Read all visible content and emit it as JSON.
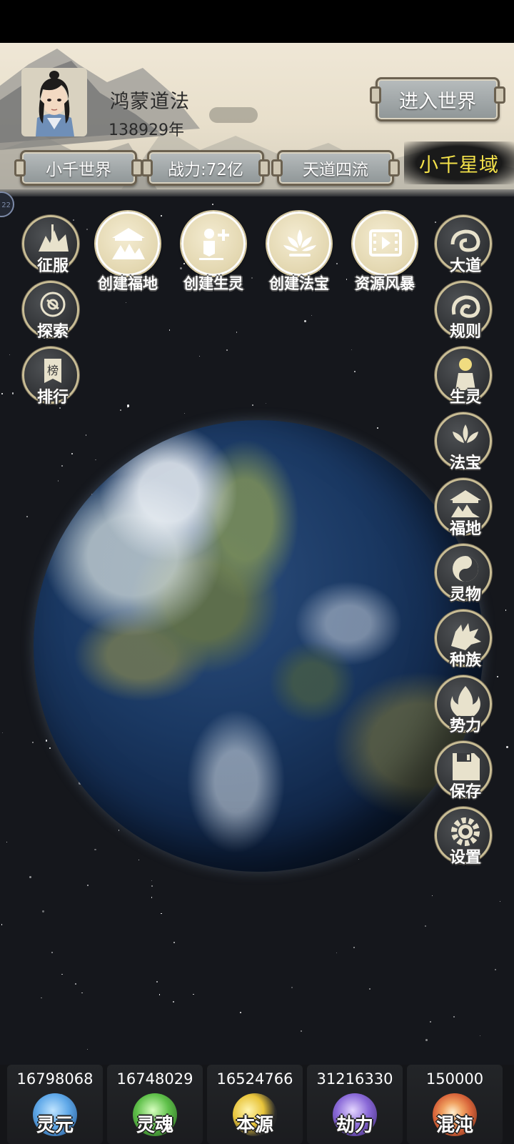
{
  "player": {
    "name": "鸿蒙道法",
    "age": "138929年"
  },
  "header": {
    "enter_world": "进入世界",
    "tabs": [
      "小千世界",
      "战力:72亿",
      "天道四流"
    ],
    "region": "小千星域",
    "side_tab": "22"
  },
  "actions_top": [
    {
      "label": "创建福地",
      "icon": "shrine-icon"
    },
    {
      "label": "创建生灵",
      "icon": "add-person-icon"
    },
    {
      "label": "创建法宝",
      "icon": "lotus-icon"
    },
    {
      "label": "资源风暴",
      "icon": "video-icon"
    }
  ],
  "left_menu": [
    {
      "label": "征服",
      "icon": "conquer-icon"
    },
    {
      "label": "探索",
      "icon": "compass-icon"
    },
    {
      "label": "排行",
      "icon": "ranking-icon"
    }
  ],
  "right_menu": [
    {
      "label": "大道",
      "icon": "cloud-swirl-icon"
    },
    {
      "label": "规则",
      "icon": "rule-swirl-icon"
    },
    {
      "label": "生灵",
      "icon": "figure-icon"
    },
    {
      "label": "法宝",
      "icon": "lotus-icon"
    },
    {
      "label": "福地",
      "icon": "shrine-icon"
    },
    {
      "label": "灵物",
      "icon": "yin-yang-icon"
    },
    {
      "label": "种族",
      "icon": "dragon-icon"
    },
    {
      "label": "势力",
      "icon": "flame-icon"
    },
    {
      "label": "保存",
      "icon": "floppy-icon"
    },
    {
      "label": "设置",
      "icon": "gear-icon"
    }
  ],
  "resources": [
    {
      "value": "16798068",
      "name": "灵元",
      "color": "#5fa8e8"
    },
    {
      "value": "16748029",
      "name": "灵魂",
      "color": "#5fc04a"
    },
    {
      "value": "16524766",
      "name": "本源",
      "color": "#e8c43a"
    },
    {
      "value": "31216330",
      "name": "劫力",
      "color": "#8a6ad8"
    },
    {
      "value": "150000",
      "name": "混沌",
      "color": "#d8643a"
    }
  ]
}
